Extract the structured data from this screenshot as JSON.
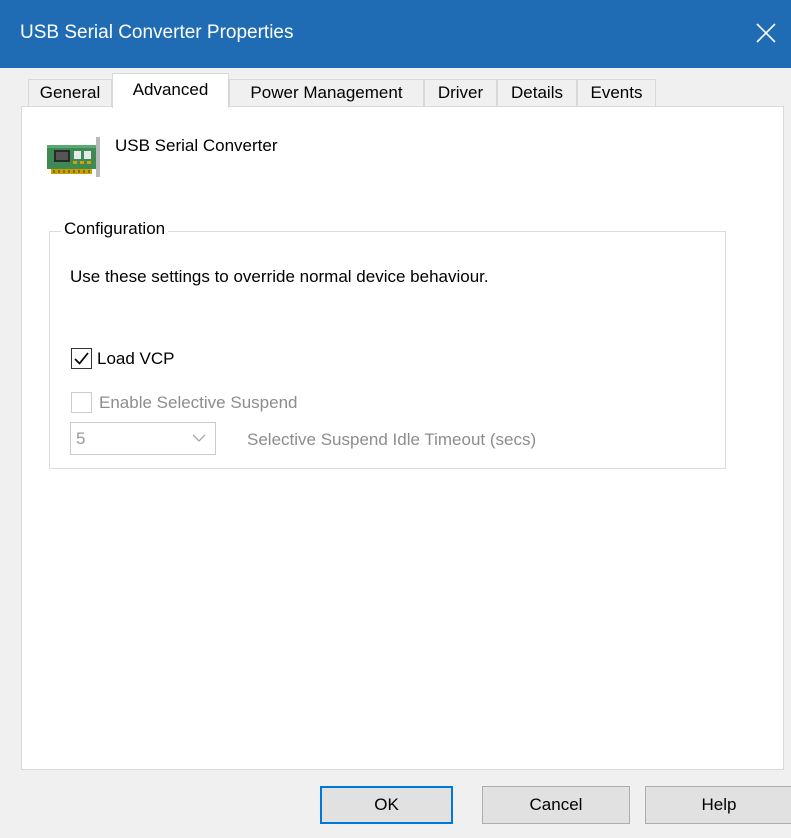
{
  "window": {
    "title": "USB Serial Converter Properties",
    "close_icon": "close-icon"
  },
  "colors": {
    "titlebar": "#1f6cb4",
    "accent": "#0078d7",
    "disabled_text": "#8d8d8d"
  },
  "tabs": [
    {
      "label": "General",
      "active": false
    },
    {
      "label": "Advanced",
      "active": true
    },
    {
      "label": "Power Management",
      "active": false
    },
    {
      "label": "Driver",
      "active": false
    },
    {
      "label": "Details",
      "active": false
    },
    {
      "label": "Events",
      "active": false
    }
  ],
  "device": {
    "icon": "circuit-board-icon",
    "name": "USB Serial Converter"
  },
  "configuration": {
    "title": "Configuration",
    "description": "Use these settings to override normal device behaviour.",
    "load_vcp": {
      "label": "Load VCP",
      "checked": true,
      "enabled": true
    },
    "selective_suspend": {
      "label": "Enable Selective Suspend",
      "checked": false,
      "enabled": false
    },
    "idle_timeout": {
      "value": "5",
      "label": "Selective Suspend Idle Timeout (secs)",
      "enabled": false
    }
  },
  "buttons": {
    "ok": "OK",
    "cancel": "Cancel",
    "help": "Help"
  }
}
